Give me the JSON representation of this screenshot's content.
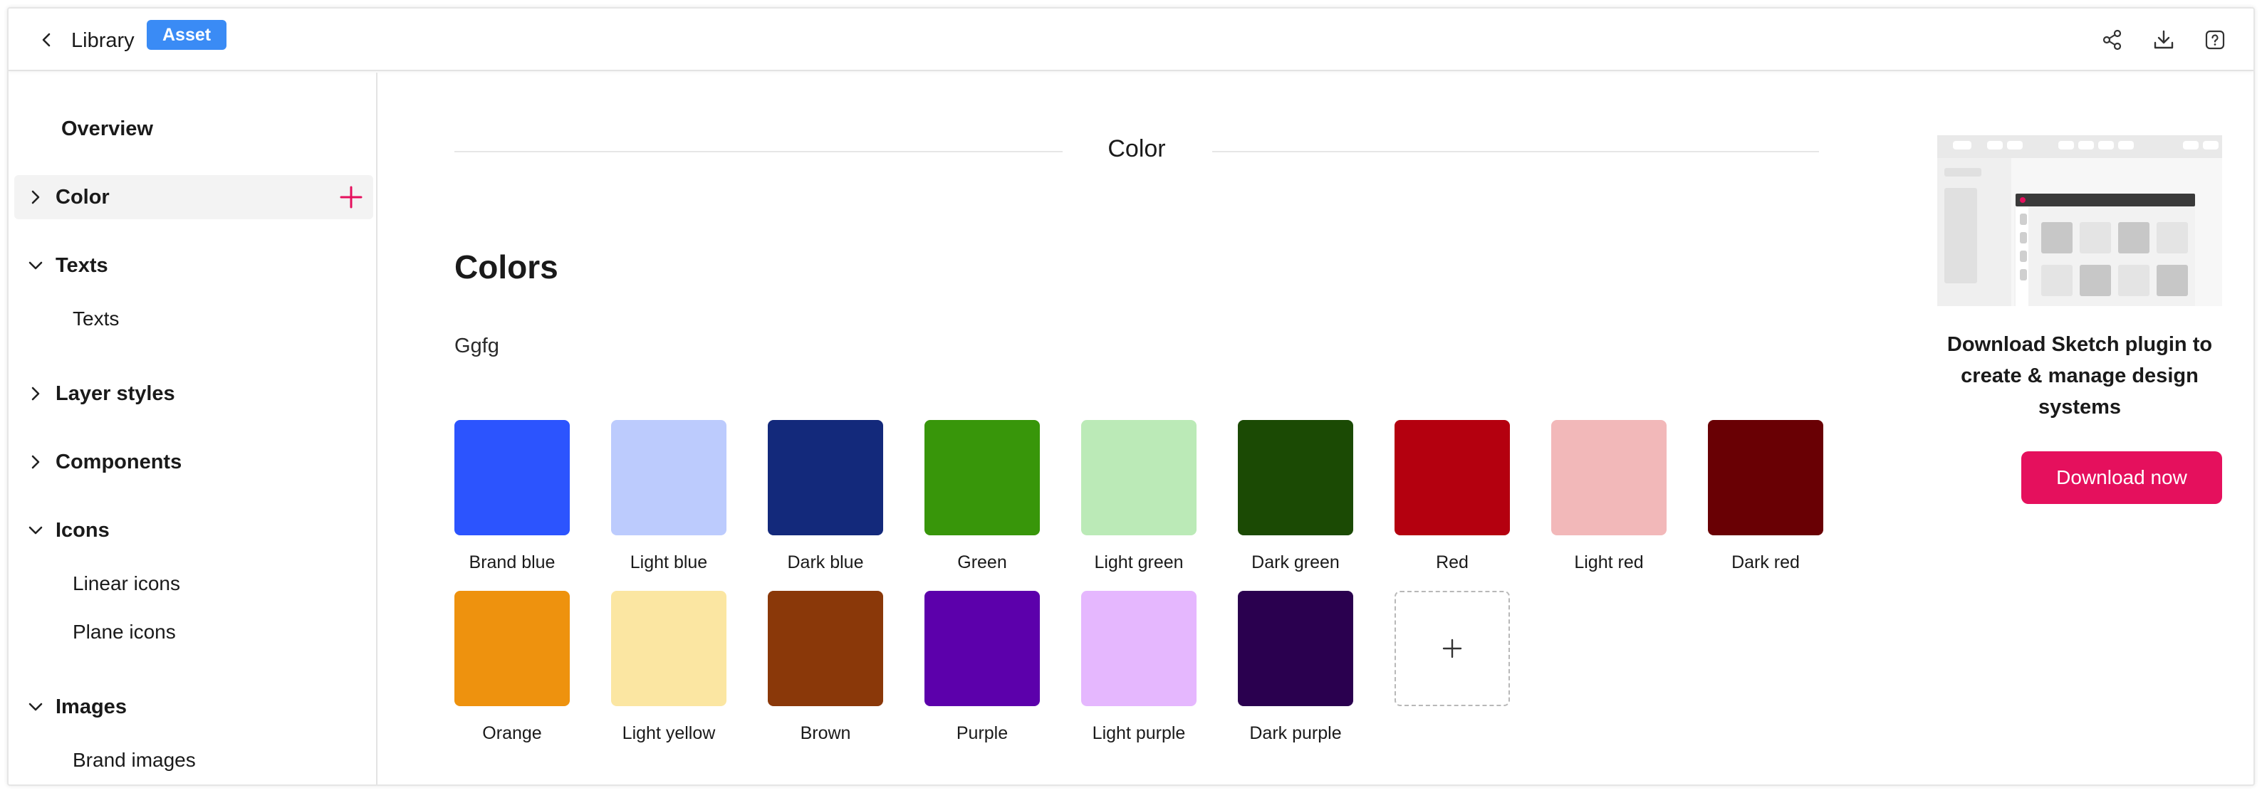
{
  "header": {
    "title": "Library",
    "badge": "Asset",
    "accent": "#3a8bf5"
  },
  "sidebar": {
    "overview": "Overview",
    "items": [
      {
        "label": "Color",
        "expanded": false,
        "active": true
      },
      {
        "label": "Texts",
        "expanded": true,
        "children": [
          "Texts"
        ]
      },
      {
        "label": "Layer styles",
        "expanded": false
      },
      {
        "label": "Components",
        "expanded": false
      },
      {
        "label": "Icons",
        "expanded": true,
        "children": [
          "Linear icons",
          "Plane icons"
        ]
      },
      {
        "label": "Images",
        "expanded": true,
        "children": [
          "Brand images"
        ]
      }
    ],
    "add_color": "#e5105d"
  },
  "main": {
    "section_title": "Color",
    "group_title": "Colors",
    "group_description": "Ggfg",
    "swatches": [
      {
        "name": "Brand blue",
        "color": "#2c54fe"
      },
      {
        "name": "Light blue",
        "color": "#bccbfd"
      },
      {
        "name": "Dark blue",
        "color": "#13297b"
      },
      {
        "name": "Green",
        "color": "#38960a"
      },
      {
        "name": "Light green",
        "color": "#bbeab7"
      },
      {
        "name": "Dark green",
        "color": "#1b4a04"
      },
      {
        "name": "Red",
        "color": "#b4000f"
      },
      {
        "name": "Light red",
        "color": "#f2b8b9"
      },
      {
        "name": "Dark red",
        "color": "#690004"
      },
      {
        "name": "Orange",
        "color": "#ee920e"
      },
      {
        "name": "Light yellow",
        "color": "#fbe6a2"
      },
      {
        "name": "Brown",
        "color": "#8a3809"
      },
      {
        "name": "Purple",
        "color": "#5c00ab"
      },
      {
        "name": "Light purple",
        "color": "#e5b7fe"
      },
      {
        "name": "Dark purple",
        "color": "#2a004f"
      }
    ]
  },
  "promo": {
    "text": "Download Sketch plugin to create & manage design systems",
    "button_label": "Download now",
    "button_color": "#e5105d"
  }
}
